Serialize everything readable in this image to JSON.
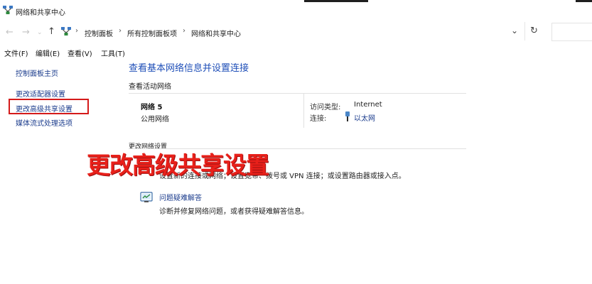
{
  "window": {
    "title": "网络和共享中心"
  },
  "address_bar": {
    "back_icon": "back-arrow",
    "forward_icon": "forward-arrow",
    "up_icon": "up-arrow",
    "crumbs": [
      "控制面板",
      "所有控制面板项",
      "网络和共享中心"
    ],
    "separator": "›",
    "dropdown_icon": "chevron-down",
    "refresh_icon": "refresh"
  },
  "menu": {
    "items": [
      "文件(F)",
      "编辑(E)",
      "查看(V)",
      "工具(T)"
    ]
  },
  "sidebar": {
    "items": [
      {
        "label": "控制面板主页"
      },
      {
        "label": "更改适配器设置"
      },
      {
        "label": "更改高级共享设置"
      },
      {
        "label": "媒体流式处理选项"
      }
    ],
    "highlight_color": "#d41a1a"
  },
  "main": {
    "heading": "查看基本网络信息并设置连接",
    "active_networks_title": "查看活动网络",
    "network": {
      "name": "网络 5",
      "type": "公用网络",
      "access_type_label": "访问类型:",
      "access_type_value": "Internet",
      "connection_label": "连接:",
      "connection_value": "以太网"
    },
    "change_settings_title": "更改网络设置",
    "setup_description": "设置新的连接或网络；设置宽带、拨号或 VPN 连接；或设置路由器或接入点。",
    "troubleshoot_link": "问题疑难解答",
    "troubleshoot_description": "诊断并修复网络问题，或者获得疑难解答信息。"
  },
  "overlay_caption": "更改高级共享设置",
  "colors": {
    "link": "#1a3b8c",
    "heading": "#1f4fb8",
    "overlay": "#e8201a"
  }
}
